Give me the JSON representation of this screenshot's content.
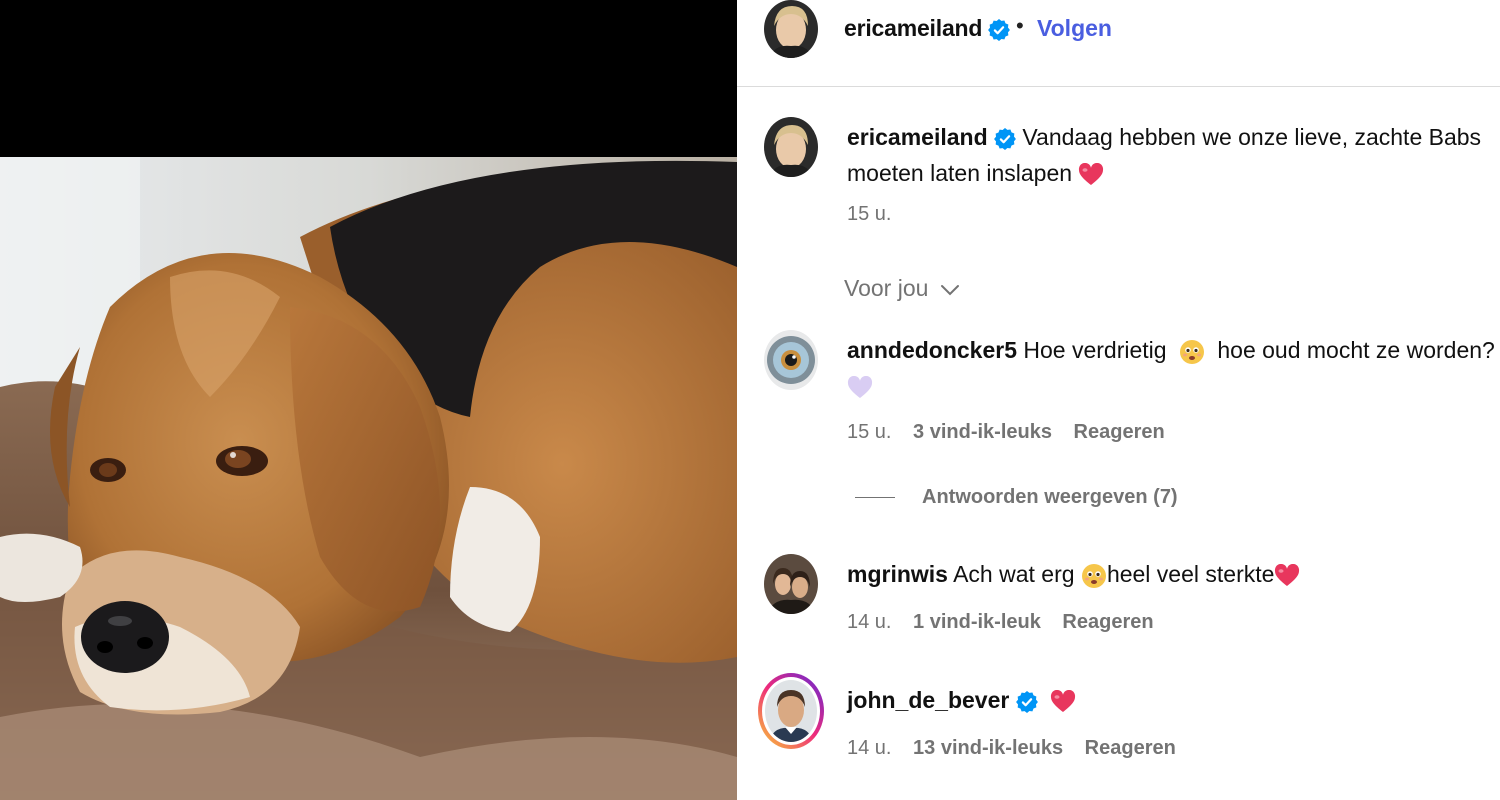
{
  "post": {
    "username": "ericameiland",
    "follow_label": "Volgen",
    "separator": "•",
    "caption_line1": "Vandaag hebben we onze lieve, zachte Babs",
    "caption_line2": "moeten laten inslapen",
    "caption_time": "15 u."
  },
  "sort_label": "Voor jou",
  "comments": [
    {
      "username": "anndedoncker5",
      "text_part1": "Hoe verdrietig",
      "text_part2": "hoe oud mocht ze worden?",
      "time": "15 u.",
      "likes": "3 vind-ik-leuks",
      "reply_label": "Reageren",
      "view_replies": "Antwoorden weergeven (7)"
    },
    {
      "username": "mgrinwis",
      "text_part1": "Ach wat erg",
      "text_part2": "heel veel sterkte",
      "time": "14 u.",
      "likes": "1 vind-ik-leuk",
      "reply_label": "Reageren"
    },
    {
      "username": "john_de_bever",
      "time": "14 u.",
      "likes": "13 vind-ik-leuks",
      "reply_label": "Reageren"
    }
  ],
  "colors": {
    "follow": "#4a5ee0",
    "verified": "#0095f6",
    "heart": "#e8365d",
    "muted": "#737373"
  },
  "icons": [
    "verified-badge-icon",
    "chevron-down-icon",
    "red-heart-emoji",
    "purple-heart-emoji",
    "worried-face-emoji"
  ]
}
